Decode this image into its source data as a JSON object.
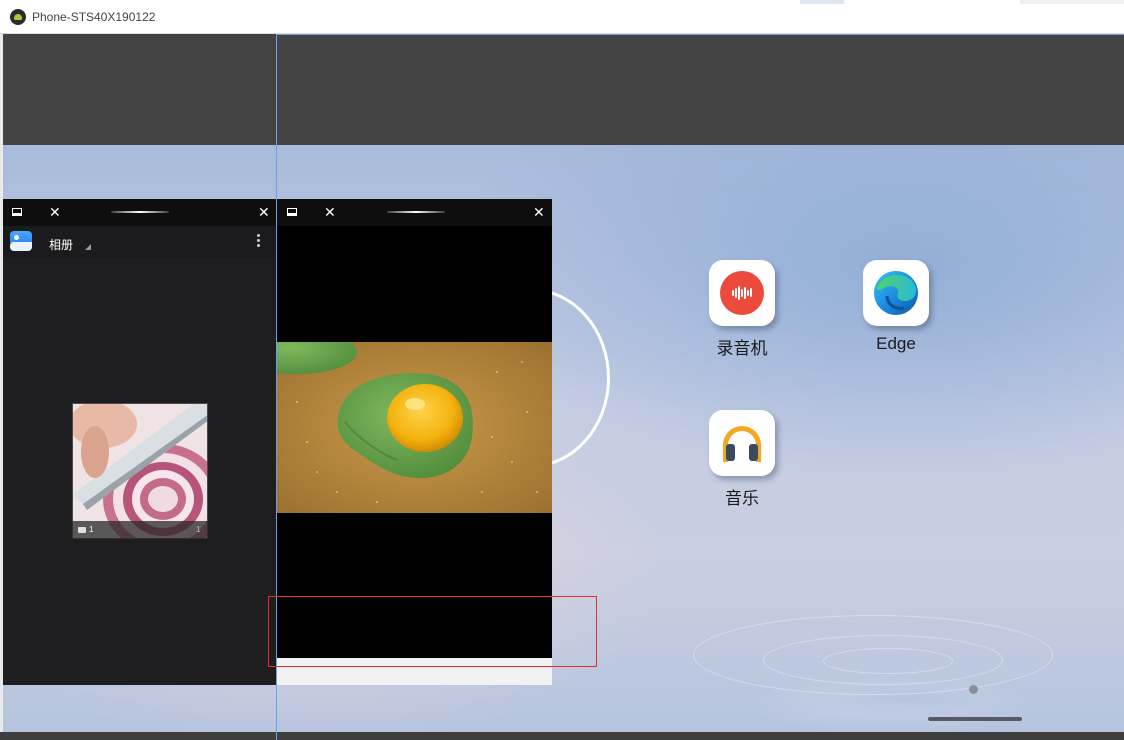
{
  "window": {
    "title": "Phone-STS40X190122"
  },
  "gallery_window": {
    "app_name": "相册",
    "album_count": "1",
    "album_count_right": "1"
  },
  "home_screen": {
    "apps": [
      {
        "label": "录音机",
        "icon": "recorder-icon"
      },
      {
        "label": "Edge",
        "icon": "edge-icon"
      },
      {
        "label": "音乐",
        "icon": "music-icon"
      }
    ]
  },
  "colors": {
    "highlight_box": "#e0312b",
    "guide_line": "#6aa0e8",
    "recorder_red": "#ec4a3c",
    "music_orange": "#f5a623"
  }
}
